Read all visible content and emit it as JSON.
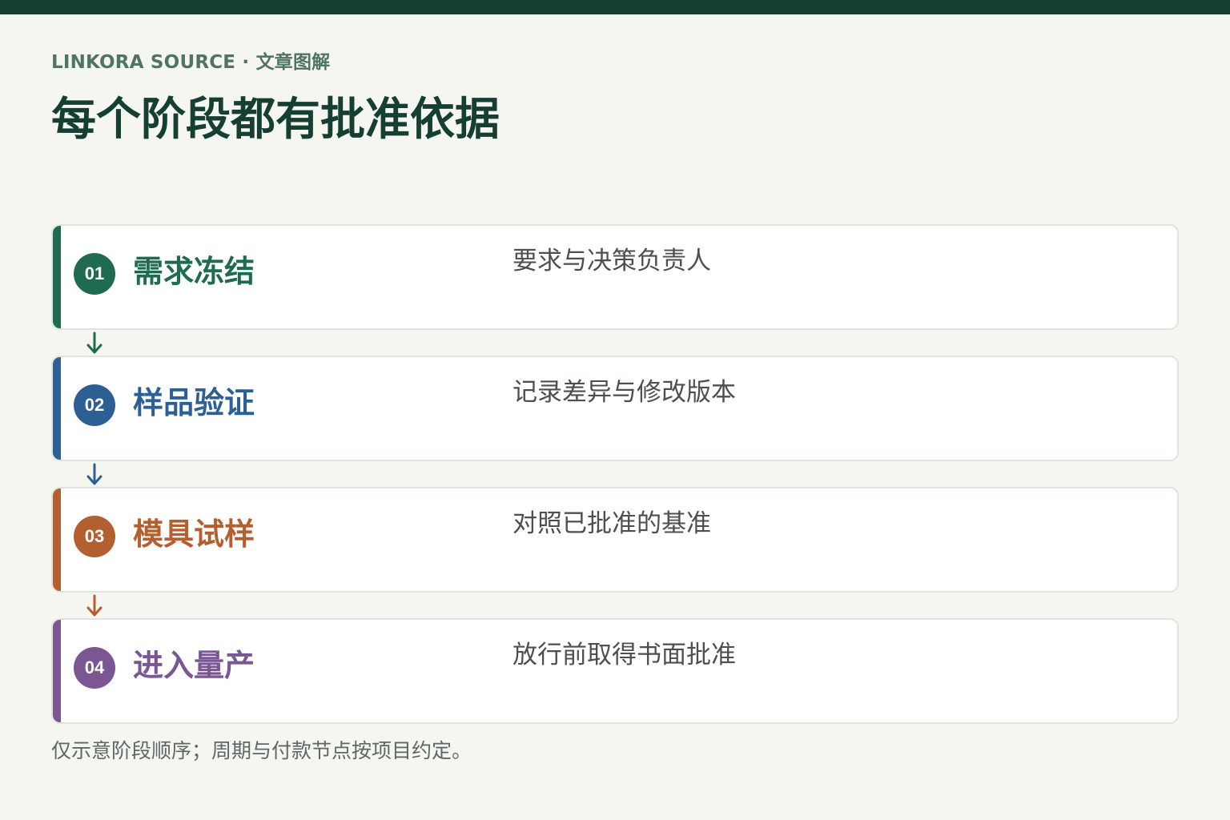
{
  "header": {
    "eyebrow": "LINKORA SOURCE · 文章图解",
    "title": "每个阶段都有批准依据"
  },
  "colors": {
    "background": "#f5f6f0",
    "top_bar": "#163f33",
    "title": "#163f33",
    "eyebrow": "#4e7462",
    "description": "#4b4f50",
    "card_border": "#dfe4dd"
  },
  "steps": [
    {
      "number": "01",
      "title": "需求冻结",
      "description": "要求与决策负责人",
      "color": "#1f6b4f"
    },
    {
      "number": "02",
      "title": "样品验证",
      "description": "记录差异与修改版本",
      "color": "#2d5f94"
    },
    {
      "number": "03",
      "title": "模具试样",
      "description": "对照已批准的基准",
      "color": "#b45f2f"
    },
    {
      "number": "04",
      "title": "进入量产",
      "description": "放行前取得书面批准",
      "color": "#7a5693"
    }
  ],
  "footer": {
    "note": "仅示意阶段顺序；周期与付款节点按项目约定。"
  }
}
